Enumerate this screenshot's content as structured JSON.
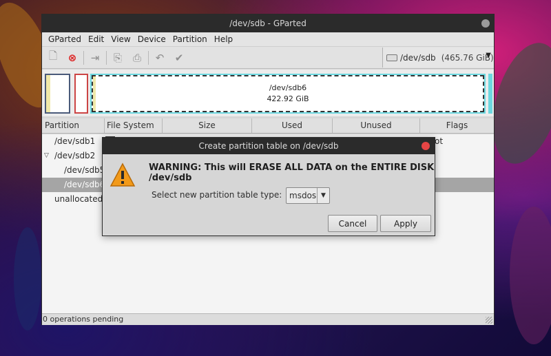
{
  "window": {
    "title": "/dev/sdb - GParted"
  },
  "menu": [
    "GParted",
    "Edit",
    "View",
    "Device",
    "Partition",
    "Help"
  ],
  "toolbar": {
    "device": "/dev/sdb",
    "device_size": "(465.76 GiB)"
  },
  "disk_map": {
    "selected_name": "/dev/sdb6",
    "selected_size": "422.92 GiB"
  },
  "columns": [
    "Partition",
    "File System",
    "Size",
    "Used",
    "Unused",
    "Flags"
  ],
  "rows": [
    {
      "name": "/dev/sdb1",
      "flags": "ot"
    },
    {
      "name": "/dev/sdb2"
    },
    {
      "name": "/dev/sdb5"
    },
    {
      "name": "/dev/sdb6"
    },
    {
      "name": "unallocated"
    }
  ],
  "status": "0 operations pending",
  "dialog": {
    "title": "Create partition table on /dev/sdb",
    "warning": "WARNING:  This will ERASE ALL DATA on the ENTIRE DISK /dev/sdb",
    "select_label": "Select new partition table type:",
    "selected_type": "msdos",
    "cancel": "Cancel",
    "apply": "Apply"
  },
  "colors": {
    "accent": "#6cd8e0",
    "close": "#e64545",
    "selected_row": "#a5a5a5"
  },
  "icons": [
    "new-icon",
    "delete-icon",
    "resize-icon",
    "copy-icon",
    "paste-icon",
    "undo-icon",
    "apply-icon",
    "warning-icon",
    "disk-icon"
  ]
}
